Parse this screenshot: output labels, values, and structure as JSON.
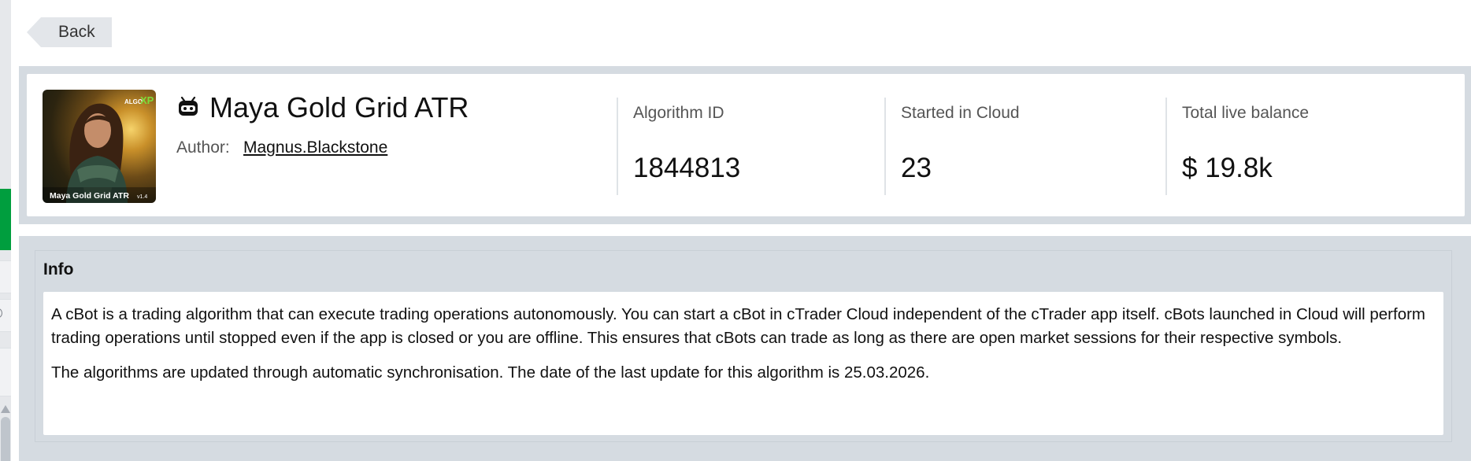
{
  "nav": {
    "back_label": "Back"
  },
  "bot": {
    "title": "Maya Gold Grid ATR",
    "author_label": "Author:",
    "author_name": "Magnus.Blackstone",
    "thumbnail": {
      "brand_text": "ALGO",
      "brand_suffix": "XP",
      "caption": "Maya Gold Grid ATR",
      "version": "v1.4"
    }
  },
  "stats": [
    {
      "label": "Algorithm ID",
      "value": "1844813"
    },
    {
      "label": "Started in Cloud",
      "value": "23"
    },
    {
      "label": "Total live balance",
      "value": "$ 19.8k"
    }
  ],
  "info": {
    "heading": "Info",
    "paragraphs": [
      "A cBot is a trading algorithm that can execute trading operations autonomously. You can start a cBot in cTrader Cloud independent of the cTrader app itself. cBots launched in Cloud will perform trading operations until stopped even if the app is closed or you are offline. This ensures that cBots can trade as long as there are open market sessions for their respective symbols.",
      "The algorithms are updated through automatic synchronisation. The date of the last update for this algorithm is 25.03.2026."
    ]
  },
  "colors": {
    "accent_green": "#009e3e",
    "panel_bg": "#d5dbe1",
    "xp_green": "#7ddc3a"
  }
}
